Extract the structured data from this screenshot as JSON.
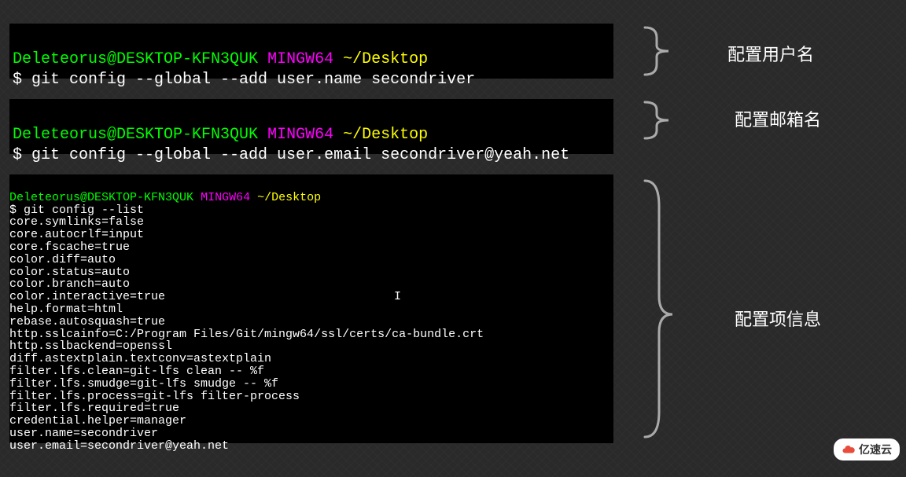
{
  "terminal1": {
    "user_host": "Deleteorus@DESKTOP-KFN3QUK",
    "env": "MINGW64",
    "path": "~/Desktop",
    "command": "$ git config --global --add user.name secondriver"
  },
  "terminal2": {
    "user_host": "Deleteorus@DESKTOP-KFN3QUK",
    "env": "MINGW64",
    "path": "~/Desktop",
    "command": "$ git config --global --add user.email secondriver@yeah.net"
  },
  "terminal3": {
    "user_host": "Deleteorus@DESKTOP-KFN3QUK",
    "env": "MINGW64",
    "path": "~/Desktop",
    "command": "$ git config --list",
    "output_lines": [
      "core.symlinks=false",
      "core.autocrlf=input",
      "core.fscache=true",
      "color.diff=auto",
      "color.status=auto",
      "color.branch=auto",
      "color.interactive=true",
      "help.format=html",
      "rebase.autosquash=true",
      "http.sslcainfo=C:/Program Files/Git/mingw64/ssl/certs/ca-bundle.crt",
      "http.sslbackend=openssl",
      "diff.astextplain.textconv=astextplain",
      "filter.lfs.clean=git-lfs clean -- %f",
      "filter.lfs.smudge=git-lfs smudge -- %f",
      "filter.lfs.process=git-lfs filter-process",
      "filter.lfs.required=true",
      "credential.helper=manager",
      "user.name=secondriver",
      "user.email=secondriver@yeah.net"
    ]
  },
  "annotations": {
    "a1": "配置用户名",
    "a2": "配置邮箱名",
    "a3": "配置项信息"
  },
  "watermark": {
    "text": "亿速云"
  }
}
